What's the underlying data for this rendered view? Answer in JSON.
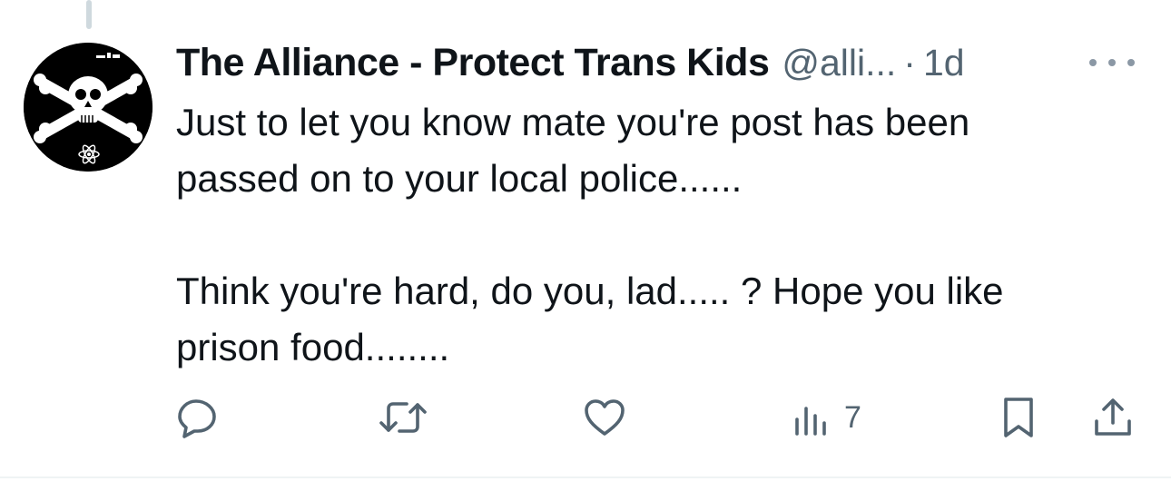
{
  "tweet": {
    "author": {
      "display_name": "The Alliance - Protect Trans Kids",
      "handle": "@alli...",
      "avatar": "skull-crossbones-avatar"
    },
    "separator": "·",
    "timestamp": "1d",
    "text": {
      "line1": "Just to let you know mate you're post has been",
      "line2": "passed on to your local police......",
      "line3": "Think you're hard, do you, lad..... ?  Hope you like",
      "line4": "prison food........"
    },
    "actions": {
      "reply_icon": "reply-icon",
      "retweet_icon": "retweet-icon",
      "like_icon": "like-icon",
      "views_icon": "views-icon",
      "views_count": "7",
      "bookmark_icon": "bookmark-icon",
      "share_icon": "share-icon"
    }
  },
  "colors": {
    "text_primary": "#0f1419",
    "text_secondary": "#536471",
    "divider": "#eff3f4"
  }
}
